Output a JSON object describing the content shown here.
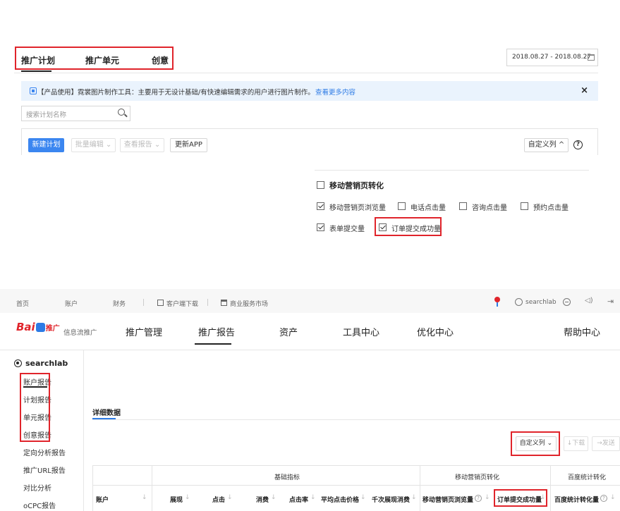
{
  "top_panel": {
    "tabs": [
      "推广计划",
      "推广单元",
      "创意"
    ],
    "date_range": "2018.08.27 - 2018.08.27",
    "notice": {
      "text": "【产品使用】霓裳图片制作工具：主要用于无设计基础/有快速编辑需求的用户进行图片制作。",
      "link": "查看更多内容",
      "close": "×"
    },
    "search": {
      "placeholder": "搜索计划名称"
    },
    "toolbar": {
      "new_plan": "新建计划",
      "batch_edit": "批量编辑",
      "view_report": "查看报告",
      "update_app": "更新APP",
      "custom_columns": "自定义列"
    },
    "column_dropdown": {
      "group_label": "移动营销页转化",
      "options": [
        {
          "label": "移动营销页浏览量",
          "checked": true
        },
        {
          "label": "电话点击量",
          "checked": false
        },
        {
          "label": "咨询点击量",
          "checked": false
        },
        {
          "label": "预约点击量",
          "checked": false
        },
        {
          "label": "表单提交量",
          "checked": true
        },
        {
          "label": "订单提交成功量",
          "checked": true
        }
      ]
    }
  },
  "bottom_panel": {
    "top_nav": {
      "links": [
        "首页",
        "账户",
        "财务",
        "客户端下载",
        "商业服务市场"
      ],
      "user": "searchlab"
    },
    "logo_text": "Bai",
    "logo_sub": "推广",
    "product_name": "信息流推广",
    "main_nav": [
      "推广管理",
      "推广报告",
      "资产",
      "工具中心",
      "优化中心",
      "帮助中心"
    ],
    "sidebar": {
      "account": "searchlab",
      "items": [
        "账户报告",
        "计划报告",
        "单元报告",
        "创意报告",
        "定向分析报告",
        "推广URL报告",
        "对比分析",
        "oCPC报告"
      ]
    },
    "section_title": "详细数据",
    "toolbar": {
      "custom_columns": "自定义列",
      "download": "下载",
      "send": "发送"
    },
    "table": {
      "groups": [
        "基础指标",
        "移动营销页转化",
        "百度统计转化"
      ],
      "columns": [
        "账户",
        "展现",
        "点击",
        "消费",
        "点击率",
        "平均点击价格",
        "千次展现消费",
        "移动营销页浏览量",
        "订单提交成功量",
        "百度统计转化量"
      ]
    }
  }
}
